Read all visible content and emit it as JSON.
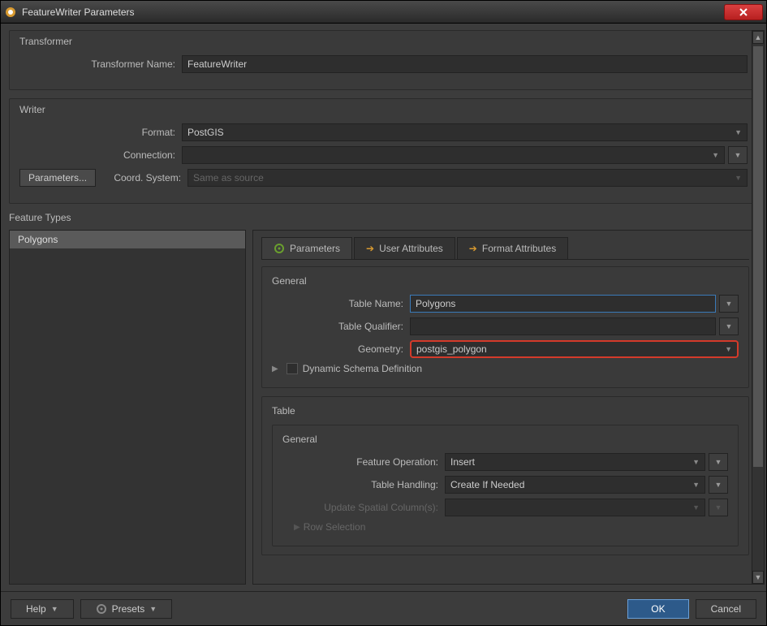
{
  "window": {
    "title": "FeatureWriter Parameters"
  },
  "transformer": {
    "section_title": "Transformer",
    "name_label": "Transformer Name:",
    "name_value": "FeatureWriter"
  },
  "writer": {
    "section_title": "Writer",
    "format_label": "Format:",
    "format_value": "PostGIS",
    "connection_label": "Connection:",
    "connection_value": "",
    "parameters_btn": "Parameters...",
    "coord_label": "Coord. System:",
    "coord_value": "Same as source"
  },
  "feature_types": {
    "section_title": "Feature Types",
    "list": [
      "Polygons"
    ],
    "tabs": {
      "parameters": "Parameters",
      "user_attrs": "User Attributes",
      "format_attrs": "Format Attributes"
    },
    "general": {
      "title": "General",
      "table_name_label": "Table Name:",
      "table_name_value": "Polygons",
      "table_qualifier_label": "Table Qualifier:",
      "table_qualifier_value": "",
      "geometry_label": "Geometry:",
      "geometry_value": "postgis_polygon",
      "dynamic_schema_label": "Dynamic Schema Definition"
    },
    "table": {
      "title": "Table",
      "subgroup_title": "General",
      "feature_op_label": "Feature Operation:",
      "feature_op_value": "Insert",
      "table_handling_label": "Table Handling:",
      "table_handling_value": "Create If Needed",
      "update_spatial_label": "Update Spatial Column(s):",
      "update_spatial_value": "",
      "row_selection_label": "Row Selection"
    }
  },
  "footer": {
    "help": "Help",
    "presets": "Presets",
    "ok": "OK",
    "cancel": "Cancel"
  }
}
